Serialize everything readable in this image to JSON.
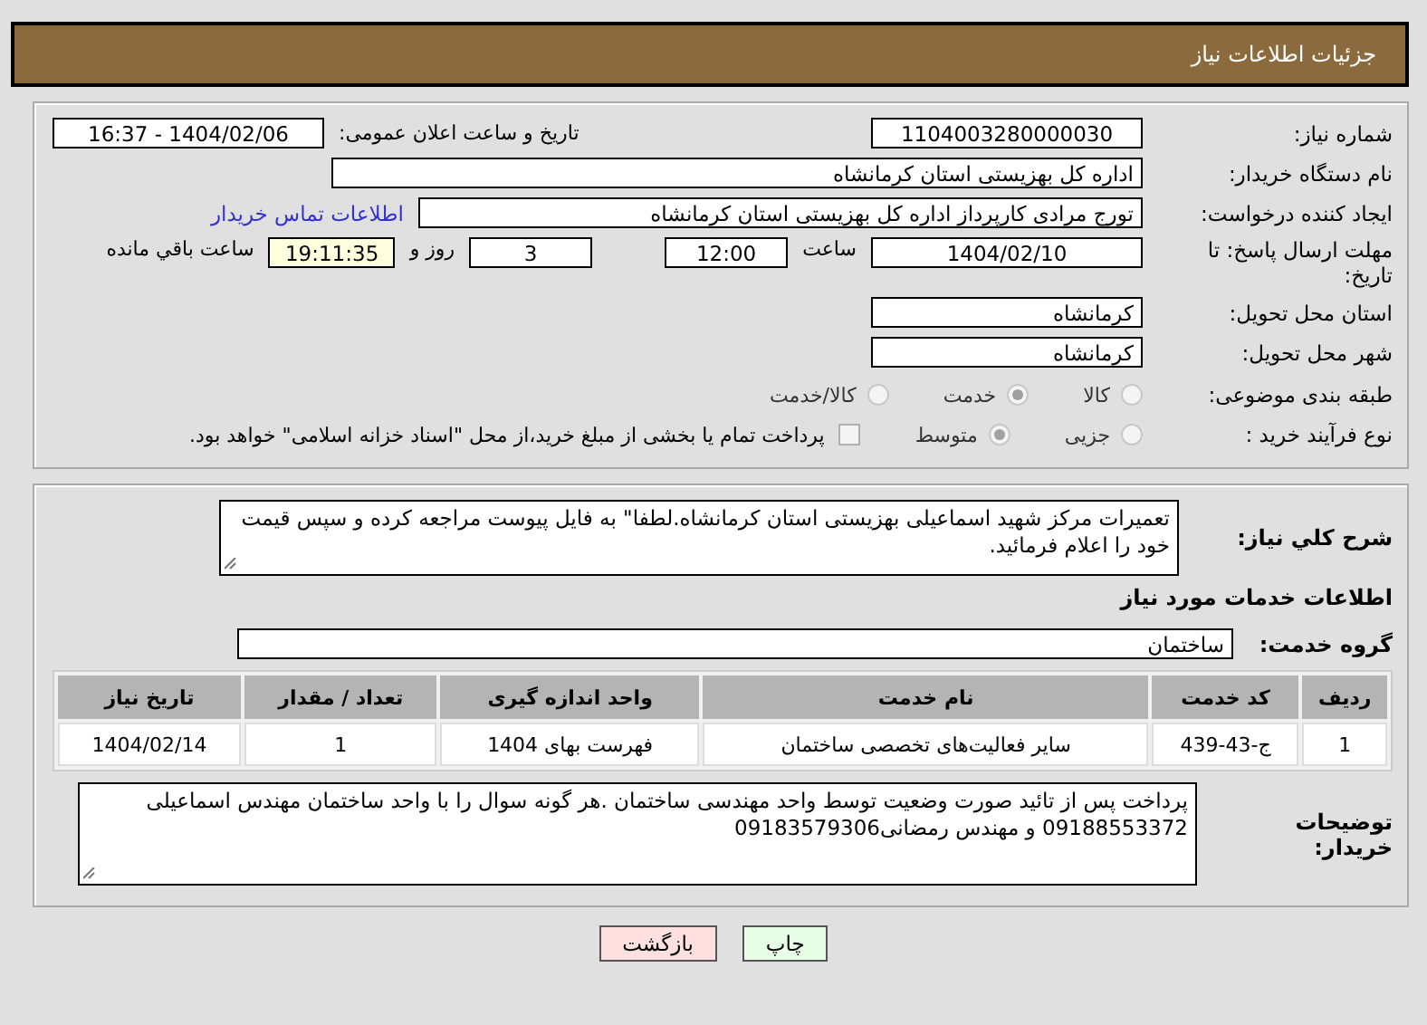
{
  "header": {
    "title": "جزئیات اطلاعات نیاز"
  },
  "need_number": {
    "label": "شماره نیاز:",
    "value": "1104003280000030"
  },
  "announce": {
    "label": "تاریخ و ساعت اعلان عمومی:",
    "value": "1404/02/06 - 16:37"
  },
  "buyer_org": {
    "label": "نام دستگاه خریدار:",
    "value": "اداره کل بهزیستی استان کرمانشاه"
  },
  "creator": {
    "label": "ایجاد کننده درخواست:",
    "value": "تورج مرادی کارپرداز  اداره کل بهزیستی استان کرمانشاه",
    "link": "اطلاعات تماس خریدار"
  },
  "deadline": {
    "label": "مهلت ارسال پاسخ: تا تاریخ:",
    "date": "1404/02/10",
    "time_label": "ساعت",
    "time": "12:00",
    "days": "3",
    "days_label": "روز و",
    "remaining": "19:11:35",
    "remaining_label": "ساعت باقي مانده"
  },
  "province": {
    "label": "استان محل تحویل:",
    "value": "کرمانشاه"
  },
  "city": {
    "label": "شهر محل تحویل:",
    "value": "کرمانشاه"
  },
  "category": {
    "label": "طبقه بندی موضوعی:",
    "options": [
      {
        "label": "کالا",
        "selected": false
      },
      {
        "label": "خدمت",
        "selected": true
      },
      {
        "label": "کالا/خدمت",
        "selected": false
      }
    ]
  },
  "purchase_type": {
    "label": "نوع فرآیند خرید :",
    "options": [
      {
        "label": "جزیی",
        "selected": false
      },
      {
        "label": "متوسط",
        "selected": true
      }
    ],
    "payment": {
      "label": "پرداخت تمام یا بخشی از مبلغ خرید،از محل \"اسناد خزانه اسلامی\" خواهد بود.",
      "checked": false
    }
  },
  "description": {
    "label": "شرح كلي نياز:",
    "value": "تعمیرات مرکز شهید اسماعیلی  بهزیستی استان کرمانشاه.لطفا\" به فایل پیوست مراجعه کرده و سپس قیمت خود را اعلام فرمائید."
  },
  "services_heading": "اطلاعات خدمات مورد نیاز",
  "service_group": {
    "label": "گروه خدمت:",
    "value": "ساختمان"
  },
  "table": {
    "columns": [
      "ردیف",
      "کد خدمت",
      "نام خدمت",
      "واحد اندازه گیری",
      "تعداد / مقدار",
      "تاریخ نیاز"
    ],
    "rows": [
      [
        "1",
        "ج-43-439",
        "سایر فعالیت‌های تخصصی ساختمان",
        "فهرست بهای 1404",
        "1",
        "1404/02/14"
      ]
    ]
  },
  "buyer_notes": {
    "label": "توضیحات خریدار:",
    "value": "پرداخت پس از تائید صورت وضعیت توسط واحد مهندسی ساختمان .هر گونه سوال را با واحد ساختمان مهندس اسماعیلی 09188553372 و مهندس رمضانی09183579306"
  },
  "buttons": [
    {
      "label": "چاپ",
      "kind": "print"
    },
    {
      "label": "بازگشت",
      "kind": "back"
    }
  ]
}
